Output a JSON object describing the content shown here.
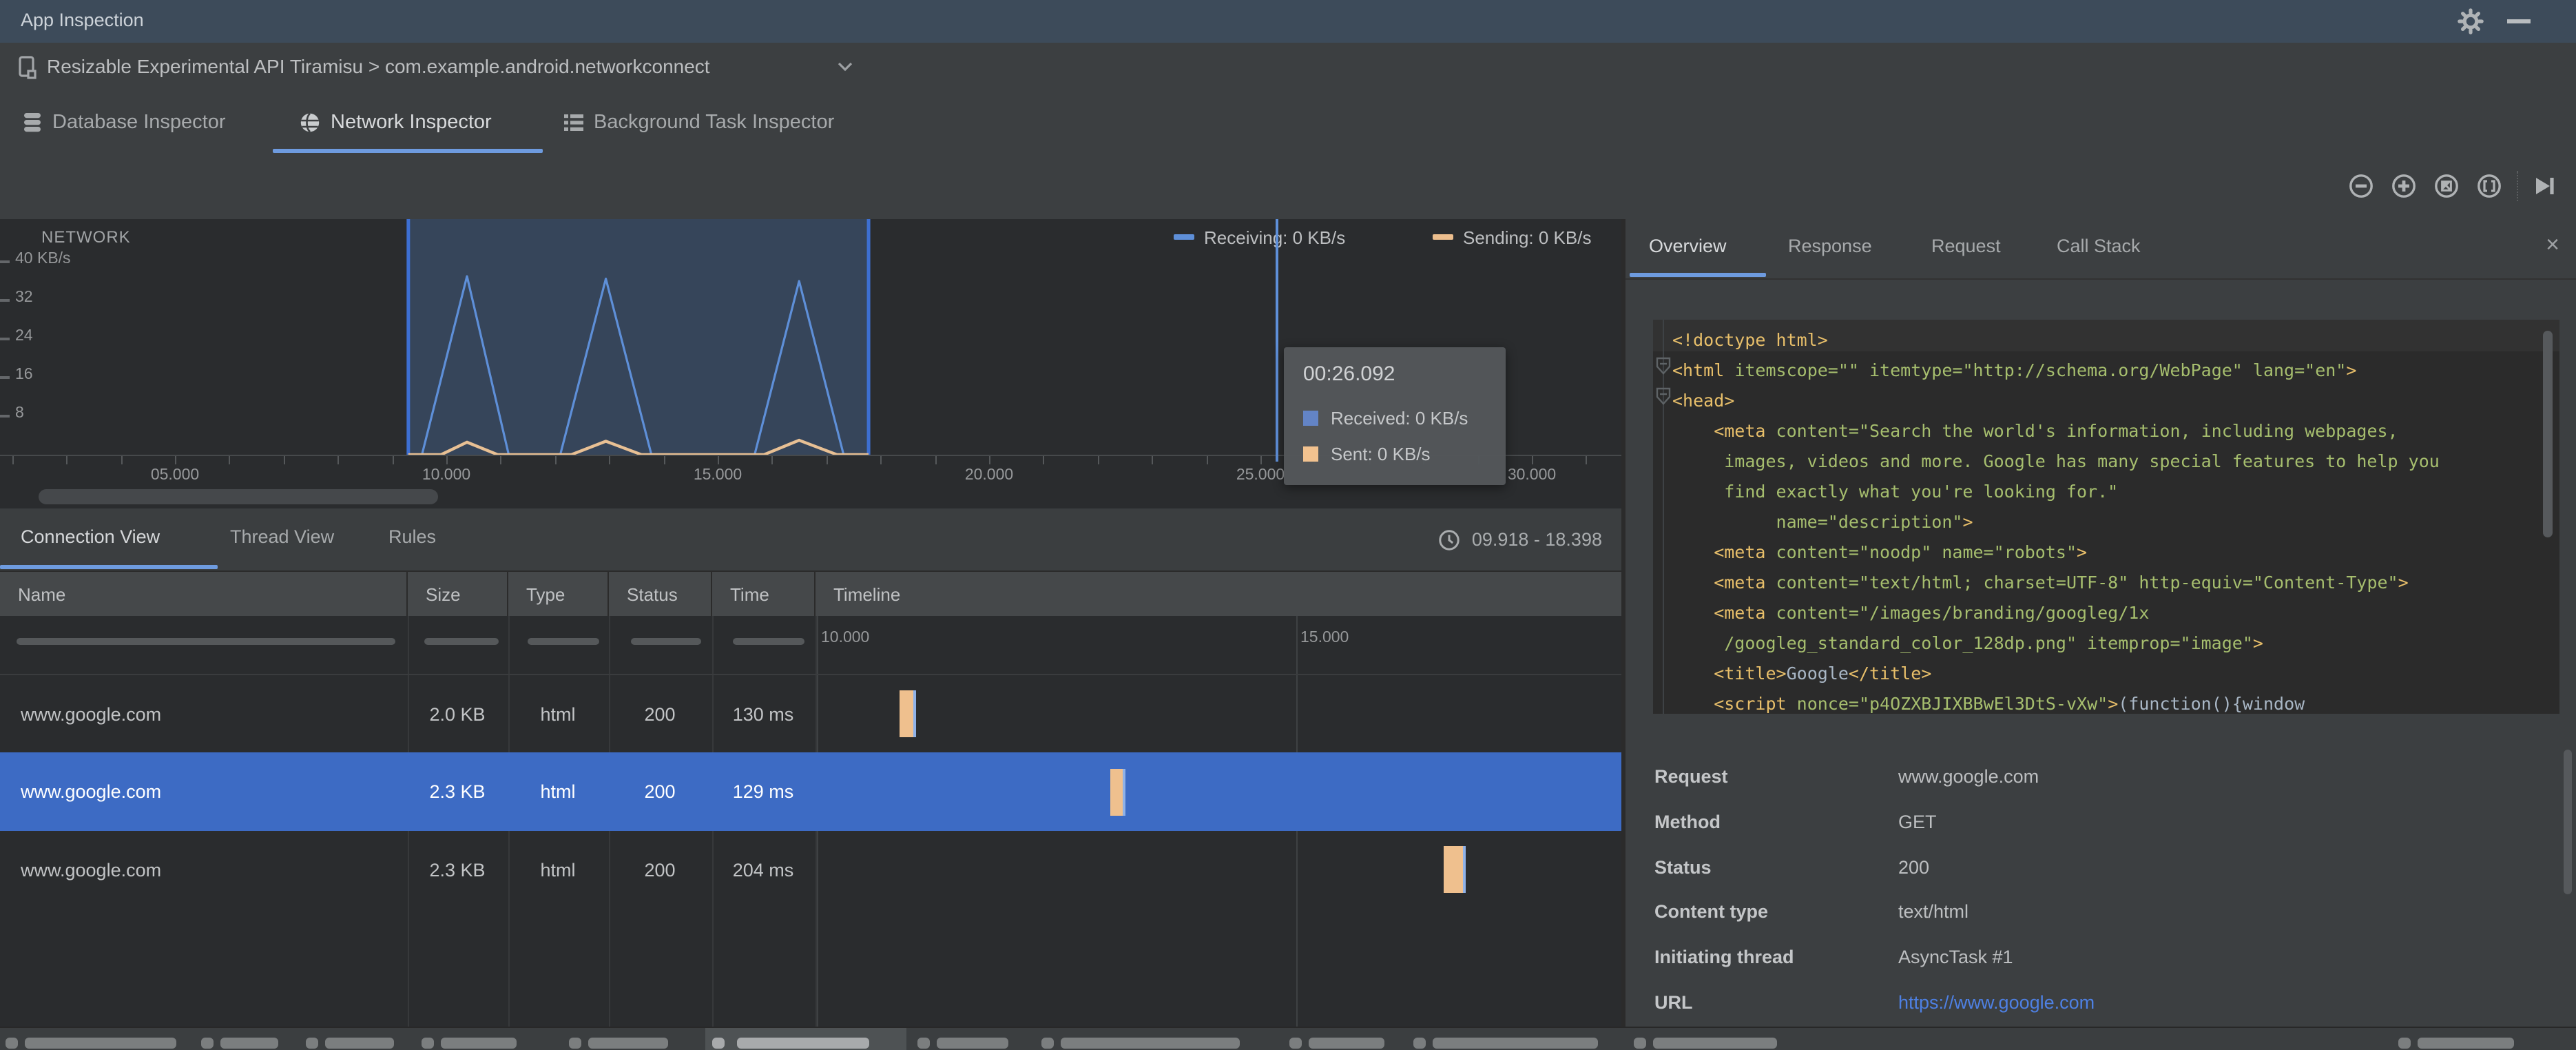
{
  "title_bar": {
    "title": "App Inspection"
  },
  "process_bar": {
    "selection": "Resizable Experimental API Tiramisu > com.example.android.networkconnect"
  },
  "inspector_tabs": {
    "tabs": [
      {
        "label": "Database Inspector",
        "icon": "database-icon",
        "active": false
      },
      {
        "label": "Network Inspector",
        "icon": "globe-icon",
        "active": true
      },
      {
        "label": "Background Task Inspector",
        "icon": "list-icon",
        "active": false
      }
    ]
  },
  "toolbar": {
    "icons": [
      "zoom-out",
      "zoom-in",
      "reset-zoom",
      "zoom-to-selection",
      "skip-to-end"
    ]
  },
  "network_chart": {
    "title": "NETWORK",
    "legend": [
      {
        "label": "Receiving: 0 KB/s",
        "color": "#5E8FD8"
      },
      {
        "label": "Sending: 0 KB/s",
        "color": "#ECBE8D"
      }
    ],
    "y_ticks": [
      {
        "label": "40 KB/s",
        "value": 40
      },
      {
        "label": "32",
        "value": 32
      },
      {
        "label": "24",
        "value": 24
      },
      {
        "label": "16",
        "value": 16
      },
      {
        "label": "8",
        "value": 8
      }
    ],
    "x_tick_seconds": [
      5,
      10,
      15,
      20,
      25,
      30
    ],
    "x_tick_labels": [
      "05.000",
      "10.000",
      "15.000",
      "20.000",
      "25.000",
      "30.000"
    ],
    "tooltip": {
      "time": "00:26.092",
      "rows": [
        {
          "label": "Received: 0 KB/s",
          "color": "#6384C6"
        },
        {
          "label": "Sent: 0 KB/s",
          "color": "#F2C28F"
        }
      ]
    },
    "chart_data": {
      "type": "line",
      "x_unit": "seconds",
      "ylabel": "KB/s",
      "ylim": [
        0,
        44
      ],
      "selection_range_s": [
        9.3,
        17.78
      ],
      "selection_fill": "rgba(86,136,205,0.28)",
      "selection_border": "#3D6FD2",
      "series": [
        {
          "name": "Receiving",
          "color": "#5E8FD8",
          "width": 1.6,
          "points": [
            [
              9.3,
              0
            ],
            [
              9.55,
              0
            ],
            [
              10.38,
              37
            ],
            [
              11.15,
              0
            ],
            [
              12.1,
              0
            ],
            [
              12.94,
              36.5
            ],
            [
              13.78,
              0
            ],
            [
              15.68,
              0
            ],
            [
              16.5,
              36
            ],
            [
              17.32,
              0
            ],
            [
              17.78,
              0
            ]
          ]
        },
        {
          "name": "Sending",
          "color": "#E8C094",
          "width": 2.2,
          "points": [
            [
              9.3,
              0
            ],
            [
              9.9,
              0
            ],
            [
              10.38,
              2.6
            ],
            [
              10.95,
              0
            ],
            [
              12.3,
              0
            ],
            [
              12.94,
              2.8
            ],
            [
              13.6,
              0
            ],
            [
              15.85,
              0
            ],
            [
              16.5,
              3
            ],
            [
              17.2,
              0
            ],
            [
              17.78,
              0
            ]
          ]
        }
      ]
    }
  },
  "connection_section": {
    "tabs": [
      {
        "label": "Connection View",
        "active": true
      },
      {
        "label": "Thread View",
        "active": false
      },
      {
        "label": "Rules",
        "active": false
      }
    ],
    "time_range": "09.918 - 18.398",
    "table": {
      "columns": [
        "Name",
        "Size",
        "Type",
        "Status",
        "Time",
        "Timeline"
      ],
      "timeline_axis_labels": [
        "10.000",
        "15.000"
      ],
      "rows": [
        {
          "name": "www.google.com",
          "size": "2.0 KB",
          "type": "html",
          "status": "200",
          "time": "130 ms",
          "marker_t": 10.86,
          "marker_w": 10,
          "selected": false
        },
        {
          "name": "www.google.com",
          "size": "2.3 KB",
          "type": "html",
          "status": "200",
          "time": "129 ms",
          "marker_t": 13.06,
          "marker_w": 9,
          "selected": true
        },
        {
          "name": "www.google.com",
          "size": "2.3 KB",
          "type": "html",
          "status": "200",
          "time": "204 ms",
          "marker_t": 16.54,
          "marker_w": 14,
          "selected": false
        }
      ],
      "marker_color": "#EFC08E"
    }
  },
  "details_panel": {
    "tabs": [
      {
        "label": "Overview",
        "active": true
      },
      {
        "label": "Response",
        "active": false
      },
      {
        "label": "Request",
        "active": false
      },
      {
        "label": "Call Stack",
        "active": false
      }
    ],
    "close_label": "×",
    "code_lines": [
      [
        [
          "tag",
          "<!doctype html>"
        ]
      ],
      [
        [
          "tag",
          "<html"
        ],
        [
          "grn",
          " itemscope=\"\" itemtype=\"http://schema.org/WebPage\" lang=\"en\""
        ],
        [
          "tag",
          ">"
        ]
      ],
      [
        [
          "tag",
          "<head>"
        ]
      ],
      [
        [
          "tag",
          "    <meta"
        ],
        [
          "grn",
          " content=\"Search the world's information, including webpages,"
        ]
      ],
      [
        [
          "grn",
          "     images, videos and more. Google has many special features to help you"
        ]
      ],
      [
        [
          "grn",
          "     find exactly what you're looking for.\""
        ]
      ],
      [
        [
          "grn",
          "          name=\"description\""
        ],
        [
          "tag",
          ">"
        ]
      ],
      [
        [
          "tag",
          "    <meta"
        ],
        [
          "grn",
          " content=\"noodp\" name=\"robots\""
        ],
        [
          "tag",
          ">"
        ]
      ],
      [
        [
          "tag",
          "    <meta"
        ],
        [
          "grn",
          " content=\"text/html; charset=UTF-8\" http-equiv=\"Content-Type\""
        ],
        [
          "tag",
          ">"
        ]
      ],
      [
        [
          "tag",
          "    <meta"
        ],
        [
          "grn",
          " content=\"/images/branding/googleg/1x"
        ]
      ],
      [
        [
          "grn",
          "     /googleg_standard_color_128dp.png\" itemprop=\"image\""
        ],
        [
          "tag",
          ">"
        ]
      ],
      [
        [
          "tag",
          "    <title>"
        ],
        [
          "txt",
          "Google"
        ],
        [
          "tag",
          "</title>"
        ]
      ],
      [
        [
          "tag",
          "    <script"
        ],
        [
          "grn",
          " nonce=\"p4OZXBJIXBBwEl3DtS-vXw\""
        ],
        [
          "tag",
          ">"
        ],
        [
          "txt",
          "(function(){window"
        ]
      ]
    ],
    "fields": [
      {
        "label": "Request",
        "value": "www.google.com",
        "link": false
      },
      {
        "label": "Method",
        "value": "GET",
        "link": false
      },
      {
        "label": "Status",
        "value": "200",
        "link": false
      },
      {
        "label": "Content type",
        "value": "text/html",
        "link": false
      },
      {
        "label": "Initiating thread",
        "value": "AsyncTask #1",
        "link": false
      },
      {
        "label": "URL",
        "value": "https://www.google.com",
        "link": true
      }
    ]
  },
  "bottom_bar": {
    "active_segment": {
      "x": 512,
      "w": 146,
      "blob_x": 535,
      "blob_w": 96
    },
    "blobs": [
      {
        "x": 18,
        "w": 110
      },
      {
        "x": 160,
        "w": 42
      },
      {
        "x": 236,
        "w": 50
      },
      {
        "x": 320,
        "w": 55
      },
      {
        "x": 427,
        "w": 58
      },
      {
        "x": 680,
        "w": 52
      },
      {
        "x": 770,
        "w": 130
      },
      {
        "x": 950,
        "w": 55
      },
      {
        "x": 1040,
        "w": 120
      },
      {
        "x": 1200,
        "w": 90
      },
      {
        "x": 1755,
        "w": 70
      }
    ]
  }
}
